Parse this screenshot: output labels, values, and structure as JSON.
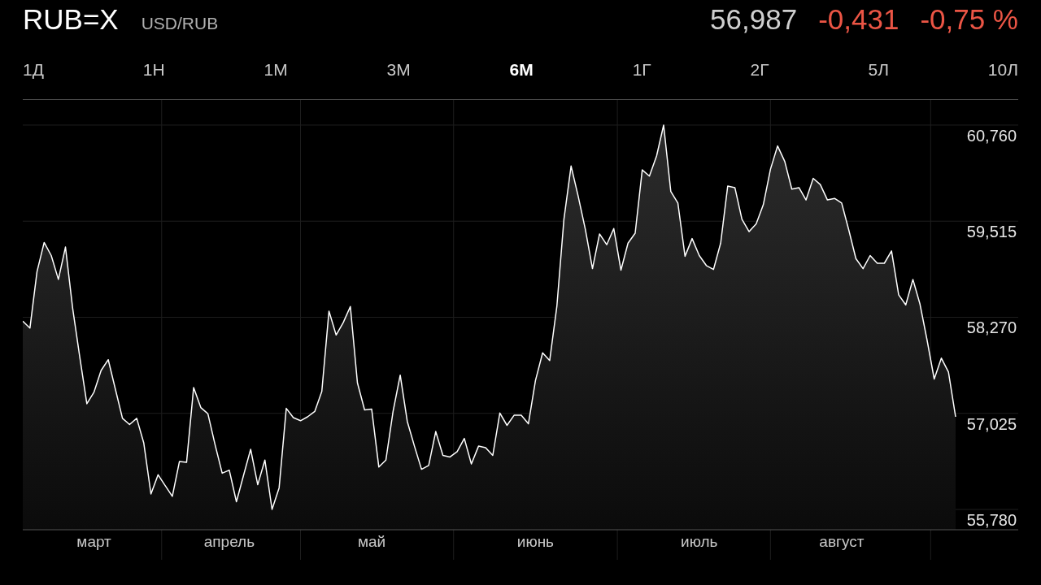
{
  "header": {
    "symbol": "RUB=X",
    "pair": "USD/RUB",
    "price": "56,987",
    "change": "-0,431",
    "change_percent": "-0,75 %",
    "negative": true
  },
  "tabs": [
    {
      "label": "1Д",
      "selected": false
    },
    {
      "label": "1Н",
      "selected": false
    },
    {
      "label": "1М",
      "selected": false
    },
    {
      "label": "3М",
      "selected": false
    },
    {
      "label": "6М",
      "selected": true
    },
    {
      "label": "1Г",
      "selected": false
    },
    {
      "label": "2Г",
      "selected": false
    },
    {
      "label": "5Л",
      "selected": false
    },
    {
      "label": "10Л",
      "selected": false
    }
  ],
  "chart": {
    "chart_data": {
      "type": "area",
      "categories": [
        null,
        null,
        null,
        null,
        null,
        null,
        null,
        null,
        null,
        null,
        "март",
        null,
        null,
        null,
        null,
        null,
        null,
        null,
        null,
        null,
        null,
        null,
        null,
        null,
        null,
        null,
        null,
        null,
        null,
        "апрель",
        null,
        null,
        null,
        null,
        null,
        null,
        null,
        null,
        null,
        null,
        null,
        null,
        null,
        null,
        null,
        null,
        null,
        null,
        null,
        "май",
        null,
        null,
        null,
        null,
        null,
        null,
        null,
        null,
        null,
        null,
        null,
        null,
        null,
        null,
        null,
        null,
        null,
        null,
        null,
        null,
        null,
        null,
        "июнь",
        null,
        null,
        null,
        null,
        null,
        null,
        null,
        null,
        null,
        null,
        null,
        null,
        null,
        null,
        null,
        null,
        null,
        null,
        null,
        null,
        null,
        null,
        "июль",
        null,
        null,
        null,
        null,
        null,
        null,
        null,
        null,
        null,
        null,
        null,
        null,
        null,
        null,
        null,
        null,
        null,
        null,
        null,
        "август",
        null,
        null,
        null,
        null,
        null,
        null,
        null,
        null,
        null,
        null,
        null,
        null,
        null,
        null,
        null,
        null
      ],
      "series": [
        {
          "color": "#ffffff",
          "values": [
            58.22,
            58.13,
            58.86,
            59.24,
            59.07,
            58.76,
            59.18,
            58.39,
            57.76,
            57.15,
            57.3,
            57.58,
            57.72,
            57.34,
            56.96,
            56.88,
            56.96,
            56.64,
            55.98,
            56.23,
            56.09,
            55.95,
            56.4,
            56.39,
            57.36,
            57.1,
            57.02,
            56.62,
            56.25,
            56.29,
            55.88,
            56.22,
            56.56,
            56.1,
            56.42,
            55.78,
            56.06,
            57.09,
            56.97,
            56.93,
            56.98,
            57.05,
            57.31,
            58.35,
            58.04,
            58.2,
            58.41,
            57.42,
            57.07,
            57.08,
            56.33,
            56.42,
            57.05,
            57.52,
            56.92,
            56.6,
            56.3,
            56.35,
            56.79,
            56.48,
            56.46,
            56.53,
            56.7,
            56.37,
            56.6,
            56.58,
            56.48,
            57.03,
            56.87,
            57.0,
            57.0,
            56.89,
            57.45,
            57.81,
            57.71,
            58.41,
            59.54,
            60.23,
            59.84,
            59.41,
            58.9,
            59.35,
            59.21,
            59.42,
            58.88,
            59.23,
            59.36,
            60.18,
            60.1,
            60.36,
            60.76,
            59.9,
            59.75,
            59.06,
            59.29,
            59.07,
            58.94,
            58.89,
            59.23,
            59.97,
            59.95,
            59.54,
            59.38,
            59.48,
            59.73,
            60.19,
            60.49,
            60.29,
            59.93,
            59.95,
            59.79,
            60.07,
            59.99,
            59.79,
            59.81,
            59.75,
            59.4,
            59.03,
            58.9,
            59.07,
            58.97,
            58.97,
            59.13,
            58.56,
            58.43,
            58.76,
            58.44,
            57.97,
            57.47,
            57.74,
            57.56,
            56.98
          ]
        }
      ],
      "grid": true,
      "ylim": [
        55.517,
        61.086
      ],
      "yticks": [
        {
          "value": 60.76,
          "label": "60,760"
        },
        {
          "value": 59.515,
          "label": "59,515"
        },
        {
          "value": 58.27,
          "label": "58,270"
        },
        {
          "value": 57.025,
          "label": "57,025"
        },
        {
          "value": 55.78,
          "label": "55,780"
        }
      ]
    }
  }
}
